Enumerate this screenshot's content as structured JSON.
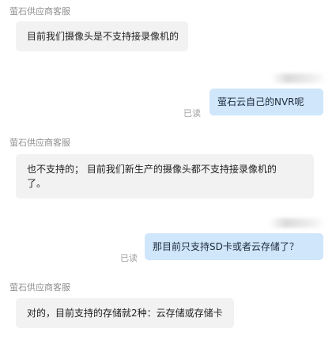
{
  "messages": [
    {
      "sender": "萤石供应商客服",
      "text": "目前我们摄像头是不支持接录像机的"
    },
    {
      "text": "萤石云自己的NVR呢",
      "status": "已读"
    },
    {
      "sender": "萤石供应商客服",
      "text_line1": "也不支持的； 目前我们新生产的摄像头都不支持接录像机的",
      "text_line2": "了。"
    },
    {
      "text": "那目前只支持SD卡或者云存储了？",
      "status": "已读"
    },
    {
      "sender": "萤石供应商客服",
      "text": "对的，目前支持的存储就2种：云存储或存储卡"
    }
  ]
}
